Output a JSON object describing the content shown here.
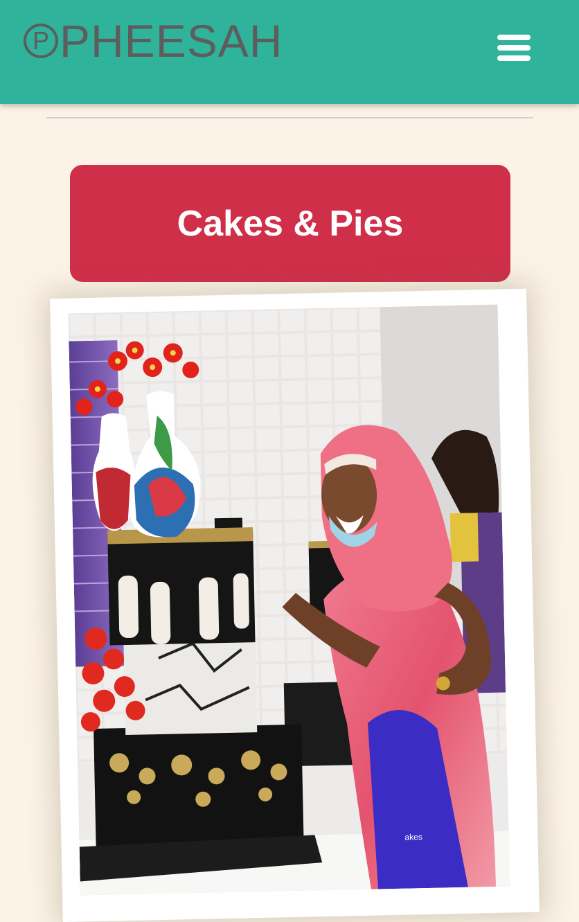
{
  "header": {
    "logo_mark": "P",
    "logo_text": "PHEESAH",
    "background_color": "#2fb39a",
    "menu_icon": "hamburger-menu-icon"
  },
  "main": {
    "category_label": "Cakes & Pies",
    "category_color": "#d02f49",
    "background_color": "#fbf3e6"
  },
  "photo": {
    "apron_text": "akes"
  }
}
